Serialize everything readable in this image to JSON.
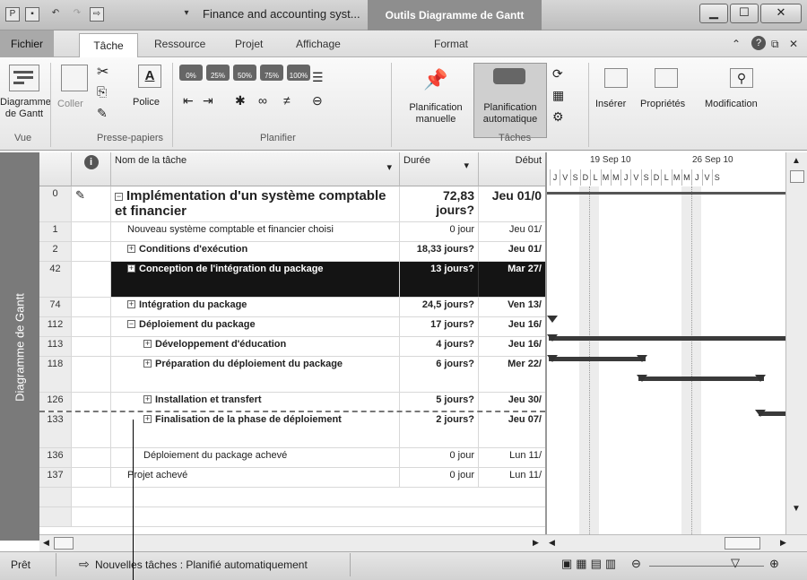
{
  "titlebar": {
    "title": "Finance and accounting syst...",
    "context_tab": "Outils Diagramme de Gantt"
  },
  "menu": {
    "tabs": [
      "Fichier",
      "Tâche",
      "Ressource",
      "Projet",
      "Affichage",
      "Format"
    ],
    "active": "Tâche"
  },
  "ribbon": {
    "gantt_view_label": "Diagramme de Gantt",
    "paste_label": "Coller",
    "font_label": "Police",
    "percent_labels": [
      "0%",
      "25%",
      "50%",
      "75%",
      "100%"
    ],
    "manual_label": "Planification manuelle",
    "auto_label": "Planification automatique",
    "insert_label": "Insérer",
    "props_label": "Propriétés",
    "modify_label": "Modification",
    "groups": {
      "vue": "Vue",
      "presse": "Presse-papiers",
      "planifier": "Planifier",
      "taches": "Tâches"
    }
  },
  "sidebar": {
    "label": "Diagramme de Gantt"
  },
  "grid": {
    "headers": {
      "name": "Nom de la tâche",
      "duration": "Durée",
      "start": "Début"
    },
    "rows": [
      {
        "id": "0",
        "name": "Implémentation d'un système comptable et financier",
        "duration": "72,83 jours?",
        "start": "Jeu 01/0",
        "exp": "−",
        "level": 0
      },
      {
        "id": "1",
        "name": "Nouveau système comptable et financier choisi",
        "duration": "0 jour",
        "start": "Jeu 01/",
        "exp": "",
        "level": 1
      },
      {
        "id": "2",
        "name": "Conditions d'exécution",
        "duration": "18,33 jours?",
        "start": "Jeu 01/",
        "exp": "+",
        "level": 1
      },
      {
        "id": "42",
        "name": "Conception de l'intégration du package",
        "duration": "13 jours?",
        "start": "Mar 27/",
        "exp": "+",
        "level": 1
      },
      {
        "id": "74",
        "name": "Intégration du package",
        "duration": "24,5 jours?",
        "start": "Ven 13/",
        "exp": "+",
        "level": 1
      },
      {
        "id": "112",
        "name": "Déploiement du package",
        "duration": "17 jours?",
        "start": "Jeu 16/",
        "exp": "−",
        "level": 1
      },
      {
        "id": "113",
        "name": "Développement d'éducation",
        "duration": "4 jours?",
        "start": "Jeu 16/",
        "exp": "+",
        "level": 2
      },
      {
        "id": "118",
        "name": "Préparation du déploiement du package",
        "duration": "6 jours?",
        "start": "Mer 22/",
        "exp": "+",
        "level": 2
      },
      {
        "id": "126",
        "name": "Installation et transfert",
        "duration": "5 jours?",
        "start": "Jeu 30/",
        "exp": "+",
        "level": 2
      },
      {
        "id": "133",
        "name": "Finalisation de la phase de déploiement",
        "duration": "2 jours?",
        "start": "Jeu 07/",
        "exp": "+",
        "level": 2
      },
      {
        "id": "136",
        "name": "Déploiement du package achevé",
        "duration": "0 jour",
        "start": "Lun 11/",
        "exp": "",
        "level": 2
      },
      {
        "id": "137",
        "name": "Projet achevé",
        "duration": "0 jour",
        "start": "Lun 11/",
        "exp": "",
        "level": 1
      }
    ]
  },
  "gantt": {
    "week1": "19 Sep 10",
    "week2": "26 Sep 10",
    "days": [
      "J",
      "V",
      "S",
      "D",
      "L",
      "M",
      "M",
      "J",
      "V",
      "S",
      "D",
      "L",
      "M",
      "M",
      "J",
      "V",
      "S"
    ]
  },
  "status": {
    "ready": "Prêt",
    "new_tasks": "Nouvelles tâches : Planifié automatiquement"
  }
}
